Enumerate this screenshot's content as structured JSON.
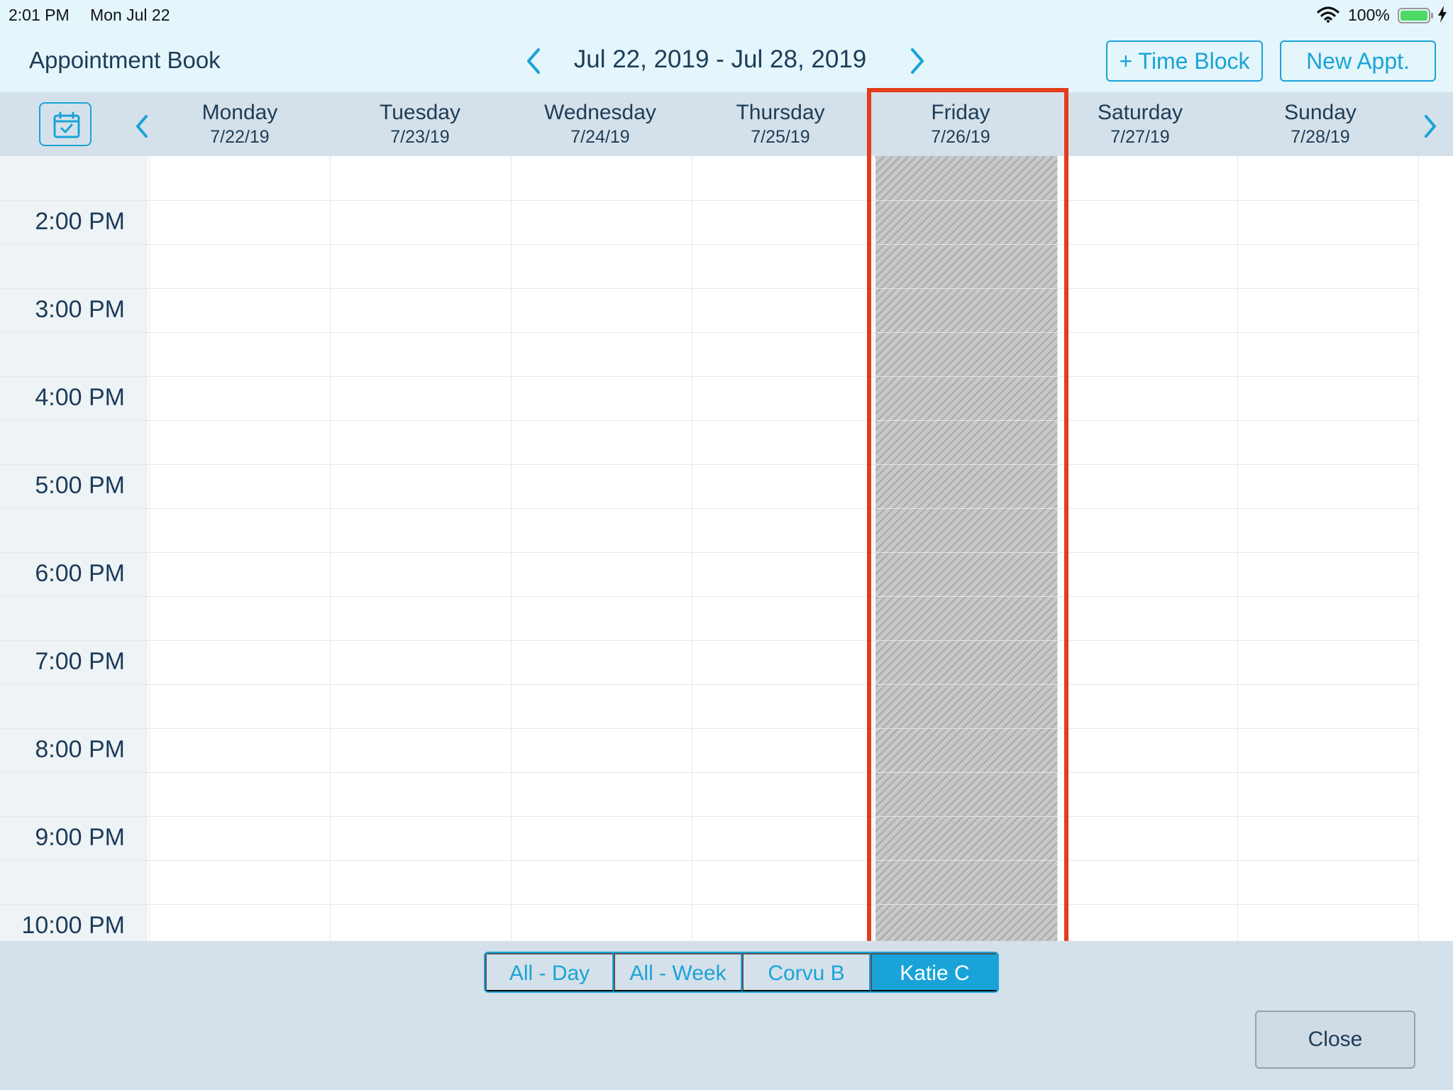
{
  "status_bar": {
    "time": "2:01 PM",
    "date": "Mon Jul 22",
    "battery": "100%",
    "battery_level": 1.0,
    "icons": [
      "wifi-icon",
      "battery-icon",
      "charging-bolt-icon"
    ]
  },
  "header": {
    "title": "Appointment Book",
    "date_range": "Jul 22, 2019 - Jul 28, 2019",
    "time_block_label": "+ Time Block",
    "new_appt_label": "New Appt.",
    "icons": [
      "chevron-left-icon",
      "chevron-right-icon"
    ]
  },
  "days": [
    {
      "name": "Monday",
      "date": "7/22/19"
    },
    {
      "name": "Tuesday",
      "date": "7/23/19"
    },
    {
      "name": "Wednesday",
      "date": "7/24/19"
    },
    {
      "name": "Thursday",
      "date": "7/25/19"
    },
    {
      "name": "Friday",
      "date": "7/26/19"
    },
    {
      "name": "Saturday",
      "date": "7/27/19"
    },
    {
      "name": "Sunday",
      "date": "7/28/19"
    }
  ],
  "blocked_day": "Friday",
  "times": [
    "2:00 PM",
    "3:00 PM",
    "4:00 PM",
    "5:00 PM",
    "6:00 PM",
    "7:00 PM",
    "8:00 PM",
    "9:00 PM",
    "10:00 PM"
  ],
  "footer": {
    "segments": [
      {
        "label": "All - Day",
        "active": false
      },
      {
        "label": "All - Week",
        "active": false
      },
      {
        "label": "Corvu B",
        "active": false
      },
      {
        "label": "Katie C",
        "active": true
      }
    ],
    "close_label": "Close"
  },
  "colors": {
    "accent": "#1aa3d9",
    "header_bg": "#e4f6fc",
    "bar_bg": "#d5e1ea",
    "text": "#1d3c58",
    "highlight": "#e23d1c"
  }
}
